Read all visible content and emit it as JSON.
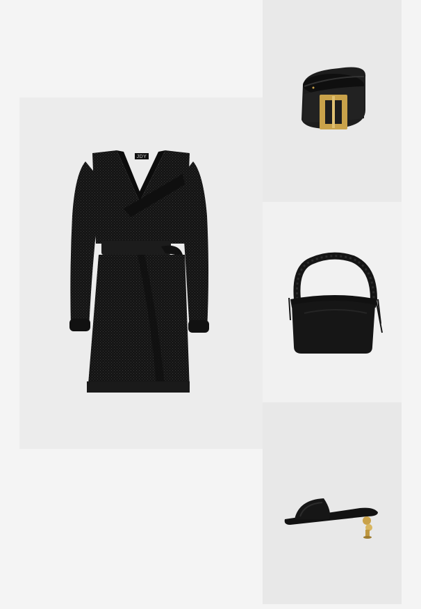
{
  "outfit": {
    "items": [
      {
        "id": "dress",
        "product": "black-wrap-mini-dress",
        "label_text": "JDY",
        "colors": {
          "fabric": "#141414",
          "background": "#ececec"
        }
      },
      {
        "id": "belt",
        "product": "black-leather-belt-gold-buckle",
        "colors": {
          "leather": "#1b1b1b",
          "buckle": "#c9a24a",
          "background": "#e9e9e9"
        }
      },
      {
        "id": "bag",
        "product": "black-ruched-handle-handbag",
        "colors": {
          "body": "#161616",
          "background": "#f1f1f1"
        }
      },
      {
        "id": "shoe",
        "product": "black-mule-sculptural-gold-heel",
        "colors": {
          "leather": "#141414",
          "heel": "#c9a24a",
          "background": "#e8e8e8"
        }
      }
    ]
  }
}
